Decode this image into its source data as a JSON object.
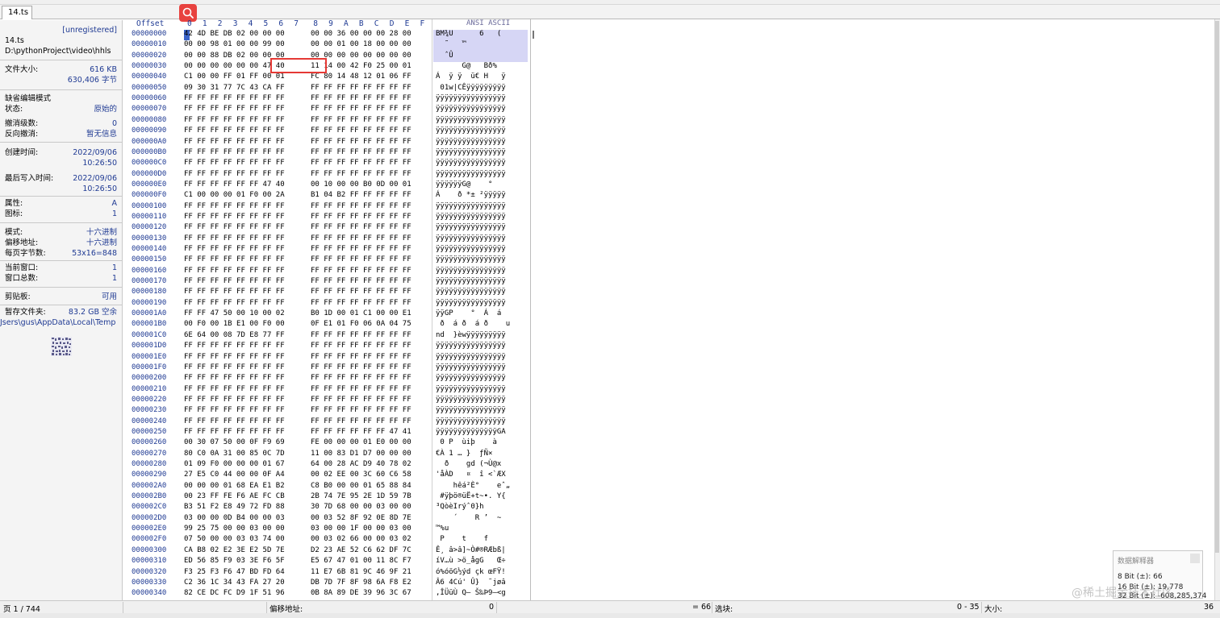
{
  "tab": {
    "label": "14.ts"
  },
  "info": {
    "registration": "[unregistered]",
    "file_name": "14.ts",
    "file_path": "D:\\pythonProject\\video\\hhls",
    "file_size_label": "文件大小:",
    "file_size_kb": "616 KB",
    "file_size_bytes": "630,406 字节",
    "edit_mode": "缺省编辑模式",
    "state_label": "状态:",
    "state_value": "原始的",
    "undo_level_label": "撤消级数:",
    "undo_level_value": "0",
    "redo_label": "反向撤消:",
    "redo_value": "暂无信息",
    "created_label": "创建时间:",
    "created_date": "2022/09/06",
    "created_time": "10:26:50",
    "modified_label": "最后写入时间:",
    "modified_date": "2022/09/06",
    "modified_time": "10:26:50",
    "attr_label": "属性:",
    "attr_value": "A",
    "icon_label": "图标:",
    "icon_value": "1",
    "mode_label": "模式:",
    "mode_value": "十六进制",
    "offset_label": "偏移地址:",
    "offset_value": "十六进制",
    "bytes_per_page_label": "每页字节数:",
    "bytes_per_page_value": "53x16=848",
    "current_window_label": "当前窗口:",
    "current_window_value": "1",
    "window_total_label": "窗口总数:",
    "window_total_value": "1",
    "clipboard_label": "剪贴板:",
    "clipboard_value": "可用",
    "temp_label": "暂存文件夹:",
    "temp_value": "83.2 GB 空余",
    "temp_path": "Jsers\\gus\\AppData\\Local\\Temp"
  },
  "hex_header": {
    "offset": "Offset",
    "columns": [
      "0",
      "1",
      "2",
      "3",
      "4",
      "5",
      "6",
      "7",
      "8",
      "9",
      "A",
      "B",
      "C",
      "D",
      "E",
      "F"
    ],
    "ascii": "ANSI ASCII"
  },
  "hex_rows": [
    {
      "off": "00000000",
      "a": "42 4D BE DB 02 00 00 00",
      "b": "00 00 36 00 00 00 28 00",
      "t": "BM¾Û      6   ("
    },
    {
      "off": "00000010",
      "a": "00 00 98 01 00 00 99 00",
      "b": "00 00 01 00 18 00 00 00",
      "t": "  ˜   ™        "
    },
    {
      "off": "00000020",
      "a": "00 00 88 DB 02 00 00 00",
      "b": "00 00 00 00 00 00 00 00",
      "t": "  ˆÛ            "
    },
    {
      "off": "00000030",
      "a": "00 00 00 00 00 00 47 40",
      "b": "11 14 00 42 F0 25 00 01",
      "t": "      G@   Bð%"
    },
    {
      "off": "00000040",
      "a": "C1 00 00 FF 01 FF 00 01",
      "b": "FC 80 14 48 12 01 06 FF",
      "t": "Á  ÿ ÿ  ü€ H   ÿ"
    },
    {
      "off": "00000050",
      "a": "09 30 31 77 7C 43 CA FF",
      "b": "FF FF FF FF FF FF FF FF",
      "t": " 01w|CÊÿÿÿÿÿÿÿÿÿ"
    },
    {
      "off": "00000060",
      "a": "FF FF FF FF FF FF FF FF",
      "b": "FF FF FF FF FF FF FF FF",
      "t": "ÿÿÿÿÿÿÿÿÿÿÿÿÿÿÿÿ"
    },
    {
      "off": "00000070",
      "a": "FF FF FF FF FF FF FF FF",
      "b": "FF FF FF FF FF FF FF FF",
      "t": "ÿÿÿÿÿÿÿÿÿÿÿÿÿÿÿÿ"
    },
    {
      "off": "00000080",
      "a": "FF FF FF FF FF FF FF FF",
      "b": "FF FF FF FF FF FF FF FF",
      "t": "ÿÿÿÿÿÿÿÿÿÿÿÿÿÿÿÿ"
    },
    {
      "off": "00000090",
      "a": "FF FF FF FF FF FF FF FF",
      "b": "FF FF FF FF FF FF FF FF",
      "t": "ÿÿÿÿÿÿÿÿÿÿÿÿÿÿÿÿ"
    },
    {
      "off": "000000A0",
      "a": "FF FF FF FF FF FF FF FF",
      "b": "FF FF FF FF FF FF FF FF",
      "t": "ÿÿÿÿÿÿÿÿÿÿÿÿÿÿÿÿ"
    },
    {
      "off": "000000B0",
      "a": "FF FF FF FF FF FF FF FF",
      "b": "FF FF FF FF FF FF FF FF",
      "t": "ÿÿÿÿÿÿÿÿÿÿÿÿÿÿÿÿ"
    },
    {
      "off": "000000C0",
      "a": "FF FF FF FF FF FF FF FF",
      "b": "FF FF FF FF FF FF FF FF",
      "t": "ÿÿÿÿÿÿÿÿÿÿÿÿÿÿÿÿ"
    },
    {
      "off": "000000D0",
      "a": "FF FF FF FF FF FF FF FF",
      "b": "FF FF FF FF FF FF FF FF",
      "t": "ÿÿÿÿÿÿÿÿÿÿÿÿÿÿÿÿ"
    },
    {
      "off": "000000E0",
      "a": "FF FF FF FF FF FF 47 40",
      "b": "00 10 00 00 B0 0D 00 01",
      "t": "ÿÿÿÿÿÿG@    °"
    },
    {
      "off": "000000F0",
      "a": "C1 00 00 00 01 F0 00 2A",
      "b": "B1 04 B2 FF FF FF FF FF",
      "t": "Á    ð *± ²ÿÿÿÿÿ"
    },
    {
      "off": "00000100",
      "a": "FF FF FF FF FF FF FF FF",
      "b": "FF FF FF FF FF FF FF FF",
      "t": "ÿÿÿÿÿÿÿÿÿÿÿÿÿÿÿÿ"
    },
    {
      "off": "00000110",
      "a": "FF FF FF FF FF FF FF FF",
      "b": "FF FF FF FF FF FF FF FF",
      "t": "ÿÿÿÿÿÿÿÿÿÿÿÿÿÿÿÿ"
    },
    {
      "off": "00000120",
      "a": "FF FF FF FF FF FF FF FF",
      "b": "FF FF FF FF FF FF FF FF",
      "t": "ÿÿÿÿÿÿÿÿÿÿÿÿÿÿÿÿ"
    },
    {
      "off": "00000130",
      "a": "FF FF FF FF FF FF FF FF",
      "b": "FF FF FF FF FF FF FF FF",
      "t": "ÿÿÿÿÿÿÿÿÿÿÿÿÿÿÿÿ"
    },
    {
      "off": "00000140",
      "a": "FF FF FF FF FF FF FF FF",
      "b": "FF FF FF FF FF FF FF FF",
      "t": "ÿÿÿÿÿÿÿÿÿÿÿÿÿÿÿÿ"
    },
    {
      "off": "00000150",
      "a": "FF FF FF FF FF FF FF FF",
      "b": "FF FF FF FF FF FF FF FF",
      "t": "ÿÿÿÿÿÿÿÿÿÿÿÿÿÿÿÿ"
    },
    {
      "off": "00000160",
      "a": "FF FF FF FF FF FF FF FF",
      "b": "FF FF FF FF FF FF FF FF",
      "t": "ÿÿÿÿÿÿÿÿÿÿÿÿÿÿÿÿ"
    },
    {
      "off": "00000170",
      "a": "FF FF FF FF FF FF FF FF",
      "b": "FF FF FF FF FF FF FF FF",
      "t": "ÿÿÿÿÿÿÿÿÿÿÿÿÿÿÿÿ"
    },
    {
      "off": "00000180",
      "a": "FF FF FF FF FF FF FF FF",
      "b": "FF FF FF FF FF FF FF FF",
      "t": "ÿÿÿÿÿÿÿÿÿÿÿÿÿÿÿÿ"
    },
    {
      "off": "00000190",
      "a": "FF FF FF FF FF FF FF FF",
      "b": "FF FF FF FF FF FF FF FF",
      "t": "ÿÿÿÿÿÿÿÿÿÿÿÿÿÿÿÿ"
    },
    {
      "off": "000001A0",
      "a": "FF FF 47 50 00 10 00 02",
      "b": "B0 1D 00 01 C1 00 00 E1",
      "t": "ÿÿGP    °  Á  á"
    },
    {
      "off": "000001B0",
      "a": "00 F0 00 1B E1 00 F0 00",
      "b": "0F E1 01 F0 06 0A 04 75",
      "t": " ð  á ð  á ð    u"
    },
    {
      "off": "000001C0",
      "a": "6E 64 00 08 7D E8 77 FF",
      "b": "FF FF FF FF FF FF FF FF",
      "t": "nd  }èwÿÿÿÿÿÿÿÿÿ"
    },
    {
      "off": "000001D0",
      "a": "FF FF FF FF FF FF FF FF",
      "b": "FF FF FF FF FF FF FF FF",
      "t": "ÿÿÿÿÿÿÿÿÿÿÿÿÿÿÿÿ"
    },
    {
      "off": "000001E0",
      "a": "FF FF FF FF FF FF FF FF",
      "b": "FF FF FF FF FF FF FF FF",
      "t": "ÿÿÿÿÿÿÿÿÿÿÿÿÿÿÿÿ"
    },
    {
      "off": "000001F0",
      "a": "FF FF FF FF FF FF FF FF",
      "b": "FF FF FF FF FF FF FF FF",
      "t": "ÿÿÿÿÿÿÿÿÿÿÿÿÿÿÿÿ"
    },
    {
      "off": "00000200",
      "a": "FF FF FF FF FF FF FF FF",
      "b": "FF FF FF FF FF FF FF FF",
      "t": "ÿÿÿÿÿÿÿÿÿÿÿÿÿÿÿÿ"
    },
    {
      "off": "00000210",
      "a": "FF FF FF FF FF FF FF FF",
      "b": "FF FF FF FF FF FF FF FF",
      "t": "ÿÿÿÿÿÿÿÿÿÿÿÿÿÿÿÿ"
    },
    {
      "off": "00000220",
      "a": "FF FF FF FF FF FF FF FF",
      "b": "FF FF FF FF FF FF FF FF",
      "t": "ÿÿÿÿÿÿÿÿÿÿÿÿÿÿÿÿ"
    },
    {
      "off": "00000230",
      "a": "FF FF FF FF FF FF FF FF",
      "b": "FF FF FF FF FF FF FF FF",
      "t": "ÿÿÿÿÿÿÿÿÿÿÿÿÿÿÿÿ"
    },
    {
      "off": "00000240",
      "a": "FF FF FF FF FF FF FF FF",
      "b": "FF FF FF FF FF FF FF FF",
      "t": "ÿÿÿÿÿÿÿÿÿÿÿÿÿÿÿÿ"
    },
    {
      "off": "00000250",
      "a": "FF FF FF FF FF FF FF FF",
      "b": "FF FF FF FF FF FF 47 41",
      "t": "ÿÿÿÿÿÿÿÿÿÿÿÿÿÿGA"
    },
    {
      "off": "00000260",
      "a": "00 30 07 50 00 0F F9 69",
      "b": "FE 00 00 00 01 E0 00 00",
      "t": " 0 P  ùiþ    à"
    },
    {
      "off": "00000270",
      "a": "80 C0 0A 31 00 85 0C 7D",
      "b": "11 00 83 D1 D7 00 00 00",
      "t": "€À 1 … }  ƒÑ×"
    },
    {
      "off": "00000280",
      "a": "01 09 F0 00 00 00 01 67",
      "b": "64 00 28 AC D9 40 78 02",
      "t": "  ð    gd (¬Ù@x"
    },
    {
      "off": "00000290",
      "a": "27 E5 C0 44 00 00 0F A4",
      "b": "00 02 EE 00 3C 60 C6 58",
      "t": "'åÀD   ¤  î <`ÆX"
    },
    {
      "off": "000002A0",
      "a": "00 00 00 01 68 EA E1 B2",
      "b": "C8 B0 00 00 01 65 88 84",
      "t": "    hêá²È°    eˆ„"
    },
    {
      "off": "000002B0",
      "a": "00 23 FF FE F6 AE FC CB",
      "b": "2B 74 7E 95 2E 1D 59 7B",
      "t": " #ÿþö®üË+t~•. Y{"
    },
    {
      "off": "000002C0",
      "a": "B3 51 F2 E8 49 72 FD 88",
      "b": "30 7D 68 00 00 03 00 00",
      "t": "³QòèIrýˆ0}h"
    },
    {
      "off": "000002D0",
      "a": "03 00 00 0D B4 00 00 03",
      "b": "00 03 52 8F 92 0E 8D 7E",
      "t": "    ´    R ’  ~"
    },
    {
      "off": "000002E0",
      "a": "99 25 75 00 00 03 00 00",
      "b": "03 00 00 1F 00 00 03 00",
      "t": "™%u"
    },
    {
      "off": "000002F0",
      "a": "07 50 00 00 03 03 74 00",
      "b": "00 03 02 66 00 00 03 02",
      "t": " P    t    f"
    },
    {
      "off": "00000300",
      "a": "CA B8 02 E2 3E E2 5D 7E",
      "b": "D2 23 AE 52 C6 62 DF 7C",
      "t": "Ê¸ â>â]~Ò#®RÆbß|"
    },
    {
      "off": "00000310",
      "a": "ED 56 85 F9 03 3E F6 5F",
      "b": "E5 67 47 01 00 11 8C F7",
      "t": "íV…ù >ö_ågG   Œ÷"
    },
    {
      "off": "00000320",
      "a": "F3 25 F3 F6 47 BD FD 64",
      "b": "11 E7 6B 81 9C 46 9F 21",
      "t": "ó%óöG½ýd çk œFŸ!"
    },
    {
      "off": "00000330",
      "a": "C2 36 1C 34 43 FA 27 20",
      "b": "DB 7D 7F 8F 98 6A F8 E2",
      "t": "Â6 4Cú' Û}  ˜jøâ"
    },
    {
      "off": "00000340",
      "a": "82 CE DC FC D9 1F 51 96",
      "b": "0B 8A 89 DE 39 96 3C 67",
      "t": "‚ÎÜüÙ Q– Š‰Þ9–<g"
    }
  ],
  "inspector": {
    "title": "数据解释器",
    "bit8": "8 Bit (±): 66",
    "bit16": "16 Bit (±): 19,778",
    "bit32": "32 Bit (±): -608,285,374"
  },
  "watermark": "@稀土掘金技术社区",
  "status": {
    "page": "页 1 / 744",
    "offset_label": "偏移地址:",
    "offset_value": "0",
    "eq_value": "= 66",
    "selection_label": "选块:",
    "selection_value": "0 - 35",
    "size_label": "大小:",
    "size_value": "36"
  }
}
